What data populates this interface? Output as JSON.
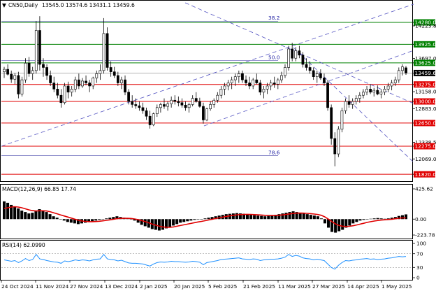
{
  "header": {
    "symbol": "CN50,Daily",
    "ohlc": "13545.0 13574.6 13431.1 13459.6",
    "macd_label": "MACD(12,26,9) 66.85 17.74",
    "rsi_label": "RSI(14) 62.0990"
  },
  "colors": {
    "candle_up": "#ffffff",
    "candle_down": "#000000",
    "support_resistance": "#e00000",
    "green_level": "#008000",
    "fib_line": "#3030a0",
    "trend_line": "#5050c0",
    "macd_signal": "#e00000",
    "rsi_line": "#1e90ff"
  },
  "chart_data": [
    {
      "type": "candlestick",
      "title": "CN50, Daily",
      "y_range": [
        11720,
        14620
      ],
      "price_ticks": [
        {
          "value": 14280.0,
          "label": "14280.0",
          "style": "green-box"
        },
        {
          "value": 14223.8,
          "label": "14223.8",
          "style": "plain"
        },
        {
          "value": 13925.0,
          "label": "13925.0",
          "style": "green-box"
        },
        {
          "value": 13697.0,
          "label": "13697.0",
          "style": "plain"
        },
        {
          "value": 13625.0,
          "label": "13625.0",
          "style": "green-box"
        },
        {
          "value": 13459.6,
          "label": "13459.6",
          "style": "current"
        },
        {
          "value": 13275.0,
          "label": "13275.0",
          "style": "red-box"
        },
        {
          "value": 13158.0,
          "label": "13158.0",
          "style": "plain"
        },
        {
          "value": 13000.0,
          "label": "13000.0",
          "style": "red-box"
        },
        {
          "value": 12883.0,
          "label": "12883.0",
          "style": "plain"
        },
        {
          "value": 12650.0,
          "label": "12650.0",
          "style": "red-box"
        },
        {
          "value": 12338.5,
          "label": "12338.5",
          "style": "plain"
        },
        {
          "value": 12275.0,
          "label": "12275.0",
          "style": "red-box"
        },
        {
          "value": 12069.0,
          "label": "12069.0",
          "style": "plain"
        },
        {
          "value": 11820.0,
          "label": "11820.0",
          "style": "red-box"
        }
      ],
      "levels": [
        {
          "value": 14280.0,
          "color": "green"
        },
        {
          "value": 13925.0,
          "color": "green"
        },
        {
          "value": 13625.0,
          "color": "green"
        },
        {
          "value": 13275.0,
          "color": "red"
        },
        {
          "value": 13000.0,
          "color": "red"
        },
        {
          "value": 12650.0,
          "color": "red"
        },
        {
          "value": 12275.0,
          "color": "red"
        },
        {
          "value": 11820.0,
          "color": "red"
        }
      ],
      "fib_levels": [
        {
          "label": "38.2",
          "value": 14300
        },
        {
          "label": "50.0",
          "value": 13660
        },
        {
          "label": "78.6",
          "value": 12120
        }
      ],
      "x_labels": [
        "24 Oct 2024",
        "11 Nov 2024",
        "27 Nov 2024",
        "13 Dec 2024",
        "2 Jan 2025",
        "20 Jan 2025",
        "5 Feb 2025",
        "21 Feb 2025",
        "11 Mar 2025",
        "27 Mar 2025",
        "14 Apr 2025",
        "1 May 2025"
      ],
      "candles": [
        [
          13480,
          13560,
          13380,
          13520
        ],
        [
          13520,
          13600,
          13420,
          13440
        ],
        [
          13440,
          13500,
          13300,
          13360
        ],
        [
          13360,
          13460,
          13280,
          13420
        ],
        [
          13420,
          13480,
          13050,
          13120
        ],
        [
          13120,
          13400,
          13080,
          13350
        ],
        [
          13350,
          13700,
          13300,
          13620
        ],
        [
          13620,
          13720,
          13400,
          13450
        ],
        [
          13450,
          13560,
          13350,
          13500
        ],
        [
          13500,
          14300,
          13450,
          14150
        ],
        [
          14150,
          14380,
          13500,
          13600
        ],
        [
          13600,
          13700,
          13400,
          13550
        ],
        [
          13550,
          13600,
          13350,
          13420
        ],
        [
          13420,
          13500,
          13250,
          13300
        ],
        [
          13300,
          13400,
          13150,
          13200
        ],
        [
          13200,
          13300,
          13050,
          13100
        ],
        [
          13100,
          13200,
          12900,
          12980
        ],
        [
          12980,
          13300,
          12950,
          13250
        ],
        [
          13250,
          13320,
          13050,
          13150
        ],
        [
          13150,
          13250,
          13080,
          13200
        ],
        [
          13200,
          13400,
          13150,
          13350
        ],
        [
          13350,
          13450,
          13200,
          13250
        ],
        [
          13250,
          13380,
          13220,
          13330
        ],
        [
          13330,
          13420,
          13260,
          13300
        ],
        [
          13300,
          13350,
          13150,
          13250
        ],
        [
          13250,
          13400,
          13200,
          13380
        ],
        [
          13380,
          13500,
          13300,
          13450
        ],
        [
          13450,
          13600,
          13350,
          13500
        ],
        [
          13500,
          14350,
          13450,
          14100
        ],
        [
          14100,
          14200,
          13500,
          13550
        ],
        [
          13550,
          13650,
          13400,
          13480
        ],
        [
          13480,
          13560,
          13380,
          13420
        ],
        [
          13420,
          13480,
          13250,
          13300
        ],
        [
          13300,
          13400,
          13200,
          13350
        ],
        [
          13350,
          13420,
          13100,
          13150
        ],
        [
          13150,
          13200,
          12950,
          13000
        ],
        [
          13000,
          13100,
          12900,
          12950
        ],
        [
          12950,
          13050,
          12880,
          12930
        ],
        [
          12930,
          13000,
          12850,
          12900
        ],
        [
          12900,
          12980,
          12800,
          12850
        ],
        [
          12850,
          12900,
          12700,
          12760
        ],
        [
          12760,
          12850,
          12560,
          12620
        ],
        [
          12620,
          12820,
          12600,
          12800
        ],
        [
          12800,
          12950,
          12750,
          12900
        ],
        [
          12900,
          12980,
          12820,
          12950
        ],
        [
          12950,
          13050,
          12880,
          12920
        ],
        [
          12920,
          13000,
          12850,
          12960
        ],
        [
          12960,
          13080,
          12900,
          13020
        ],
        [
          13020,
          13100,
          12950,
          13000
        ],
        [
          13000,
          13080,
          12920,
          12980
        ],
        [
          12980,
          13050,
          12900,
          12940
        ],
        [
          12940,
          13000,
          12850,
          12900
        ],
        [
          12900,
          12980,
          12820,
          12950
        ],
        [
          12950,
          13100,
          12920,
          13050
        ],
        [
          13050,
          13150,
          12980,
          13000
        ],
        [
          13000,
          13060,
          12900,
          12920
        ],
        [
          12920,
          12980,
          12640,
          12700
        ],
        [
          12700,
          12900,
          12680,
          12880
        ],
        [
          12880,
          13000,
          12850,
          12950
        ],
        [
          12950,
          13050,
          12900,
          13020
        ],
        [
          13020,
          13150,
          12980,
          13100
        ],
        [
          13100,
          13250,
          13050,
          13200
        ],
        [
          13200,
          13300,
          13100,
          13250
        ],
        [
          13250,
          13350,
          13180,
          13300
        ],
        [
          13300,
          13400,
          13200,
          13350
        ],
        [
          13350,
          13450,
          13250,
          13400
        ],
        [
          13400,
          13500,
          13300,
          13450
        ],
        [
          13450,
          13500,
          13300,
          13350
        ],
        [
          13350,
          13420,
          13250,
          13300
        ],
        [
          13300,
          13400,
          13200,
          13250
        ],
        [
          13250,
          13380,
          13200,
          13350
        ],
        [
          13350,
          13450,
          13280,
          13300
        ],
        [
          13300,
          13350,
          13100,
          13150
        ],
        [
          13150,
          13250,
          13050,
          13200
        ],
        [
          13200,
          13300,
          13120,
          13250
        ],
        [
          13250,
          13350,
          13180,
          13300
        ],
        [
          13300,
          13400,
          13220,
          13280
        ],
        [
          13280,
          13380,
          13200,
          13350
        ],
        [
          13350,
          13480,
          13300,
          13420
        ],
        [
          13420,
          13600,
          13380,
          13550
        ],
        [
          13550,
          13900,
          13500,
          13850
        ],
        [
          13850,
          13950,
          13650,
          13700
        ],
        [
          13700,
          13880,
          13650,
          13820
        ],
        [
          13820,
          13900,
          13700,
          13750
        ],
        [
          13750,
          13800,
          13550,
          13600
        ],
        [
          13600,
          13700,
          13500,
          13550
        ],
        [
          13550,
          13650,
          13450,
          13500
        ],
        [
          13500,
          13550,
          13350,
          13400
        ],
        [
          13400,
          13500,
          13300,
          13450
        ],
        [
          13450,
          13520,
          13350,
          13380
        ],
        [
          13380,
          13450,
          13250,
          13300
        ],
        [
          13300,
          13350,
          12850,
          12900
        ],
        [
          12900,
          12950,
          12300,
          12400
        ],
        [
          12400,
          12500,
          11950,
          12150
        ],
        [
          12150,
          12600,
          12100,
          12550
        ],
        [
          12550,
          12900,
          12500,
          12850
        ],
        [
          12850,
          13050,
          12800,
          13000
        ],
        [
          13000,
          13100,
          12900,
          12950
        ],
        [
          12950,
          13050,
          12880,
          13000
        ],
        [
          13000,
          13100,
          12950,
          13050
        ],
        [
          13050,
          13150,
          12980,
          13100
        ],
        [
          13100,
          13200,
          13050,
          13150
        ],
        [
          13150,
          13250,
          13100,
          13200
        ],
        [
          13200,
          13280,
          13120,
          13150
        ],
        [
          13150,
          13220,
          13080,
          13180
        ],
        [
          13180,
          13260,
          13100,
          13120
        ],
        [
          13120,
          13200,
          13050,
          13150
        ],
        [
          13150,
          13250,
          13100,
          13200
        ],
        [
          13200,
          13300,
          13150,
          13250
        ],
        [
          13250,
          13350,
          13180,
          13300
        ],
        [
          13300,
          13400,
          13250,
          13350
        ],
        [
          13350,
          13550,
          13300,
          13500
        ],
        [
          13500,
          13600,
          13420,
          13560
        ],
        [
          13545,
          13574.6,
          13431.1,
          13459.6
        ]
      ]
    },
    {
      "type": "bar+line",
      "title": "MACD(12,26,9)",
      "y_range": [
        -223.78,
        425.62
      ],
      "ticks": [
        {
          "value": 425.62,
          "label": "425.62"
        },
        {
          "value": 0.0,
          "label": "0.00"
        },
        {
          "value": -223.78,
          "label": "-223.78"
        }
      ],
      "histogram": [
        250,
        230,
        200,
        180,
        150,
        120,
        100,
        80,
        90,
        110,
        140,
        120,
        100,
        70,
        40,
        20,
        0,
        -20,
        -40,
        -50,
        -60,
        -70,
        -60,
        -50,
        -40,
        -30,
        -20,
        -10,
        0,
        10,
        20,
        30,
        40,
        30,
        20,
        10,
        0,
        -20,
        -50,
        -80,
        -100,
        -120,
        -140,
        -150,
        -160,
        -150,
        -130,
        -110,
        -90,
        -70,
        -50,
        -40,
        -30,
        -20,
        -10,
        -5,
        0,
        10,
        20,
        30,
        40,
        50,
        60,
        70,
        75,
        80,
        85,
        80,
        75,
        70,
        60,
        55,
        50,
        45,
        40,
        45,
        50,
        60,
        70,
        80,
        90,
        100,
        110,
        100,
        90,
        80,
        70,
        60,
        50,
        40,
        10,
        -60,
        -120,
        -180,
        -190,
        -170,
        -150,
        -120,
        -90,
        -60,
        -40,
        -20,
        -10,
        0,
        5,
        10,
        15,
        10,
        5,
        10,
        20,
        30,
        45,
        55,
        66.85
      ],
      "signal": [
        150,
        160,
        170,
        175,
        170,
        160,
        145,
        130,
        120,
        115,
        118,
        118,
        115,
        105,
        90,
        75,
        60,
        45,
        30,
        15,
        0,
        -15,
        -25,
        -32,
        -36,
        -36,
        -34,
        -30,
        -24,
        -17,
        -10,
        -2,
        6,
        10,
        12,
        11,
        9,
        3,
        -7,
        -20,
        -35,
        -52,
        -70,
        -85,
        -100,
        -110,
        -114,
        -115,
        -110,
        -100,
        -90,
        -80,
        -70,
        -60,
        -50,
        -40,
        -32,
        -22,
        -12,
        -2,
        8,
        18,
        28,
        38,
        46,
        54,
        60,
        64,
        66,
        67,
        66,
        64,
        61,
        58,
        54,
        52,
        51,
        52,
        55,
        60,
        66,
        73,
        80,
        84,
        85,
        84,
        81,
        77,
        71,
        65,
        54,
        31,
        0,
        -36,
        -67,
        -88,
        -100,
        -104,
        -101,
        -93,
        -82,
        -70,
        -58,
        -46,
        -36,
        -27,
        -19,
        -13,
        -9,
        -5,
        -1,
        5,
        13,
        17,
        17.74
      ]
    },
    {
      "type": "line",
      "title": "RSI(14)",
      "y_range": [
        0,
        100
      ],
      "ticks": [
        {
          "value": 100,
          "label": "100"
        },
        {
          "value": 70,
          "label": "70"
        },
        {
          "value": 30,
          "label": "30"
        },
        {
          "value": 0,
          "label": "0"
        }
      ],
      "values": [
        52,
        50,
        48,
        50,
        44,
        49,
        56,
        50,
        53,
        68,
        55,
        53,
        50,
        48,
        46,
        45,
        42,
        49,
        47,
        49,
        52,
        50,
        52,
        51,
        49,
        52,
        54,
        55,
        68,
        55,
        53,
        52,
        49,
        51,
        47,
        43,
        42,
        42,
        41,
        40,
        37,
        34,
        40,
        44,
        46,
        45,
        46,
        48,
        47,
        47,
        46,
        45,
        46,
        48,
        47,
        45,
        38,
        44,
        46,
        48,
        50,
        53,
        54,
        55,
        56,
        57,
        58,
        55,
        54,
        53,
        55,
        54,
        50,
        52,
        53,
        54,
        54,
        55,
        57,
        60,
        68,
        62,
        65,
        63,
        58,
        56,
        55,
        52,
        54,
        52,
        50,
        40,
        30,
        25,
        36,
        44,
        50,
        49,
        51,
        52,
        54,
        55,
        56,
        54,
        55,
        53,
        54,
        55,
        57,
        58,
        60,
        62,
        61,
        62.099
      ]
    }
  ]
}
